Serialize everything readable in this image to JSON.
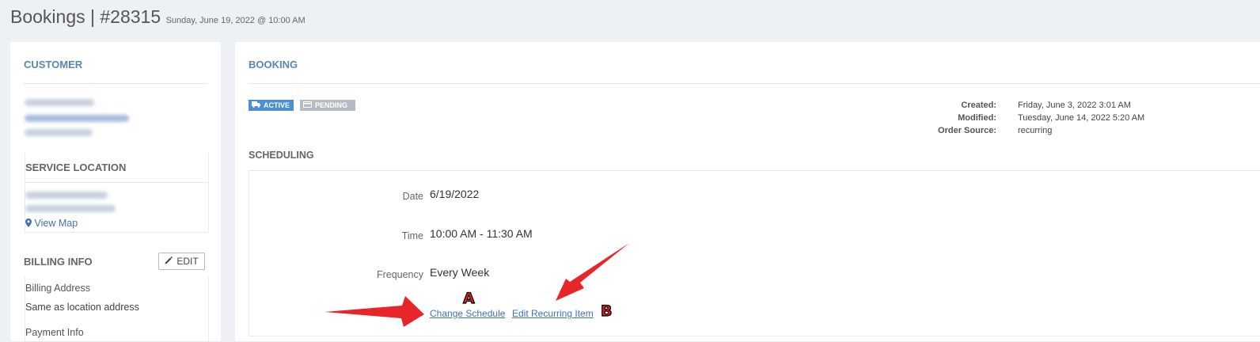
{
  "header": {
    "title": "Bookings | #28315",
    "subtitle": "Sunday, June 19, 2022 @ 10:00 AM"
  },
  "customer": {
    "title": "CUSTOMER",
    "service_location_title": "SERVICE LOCATION",
    "view_map_label": "View Map",
    "billing_info_title": "BILLING INFO",
    "edit_label": "EDIT",
    "billing_address_label": "Billing Address",
    "billing_address_value": "Same as location address",
    "payment_info_label": "Payment Info"
  },
  "booking": {
    "title": "BOOKING",
    "badges": {
      "active": "ACTIVE",
      "pending": "PENDING"
    },
    "meta": [
      {
        "key": "Created:",
        "value": "Friday, June 3, 2022 3:01 AM"
      },
      {
        "key": "Modified:",
        "value": "Tuesday, June 14, 2022 5:20 AM"
      },
      {
        "key": "Order Source:",
        "value": "recurring"
      }
    ],
    "scheduling": {
      "title": "SCHEDULING",
      "date_label": "Date",
      "date_value": "6/19/2022",
      "time_label": "Time",
      "time_value": "10:00 AM - 11:30 AM",
      "frequency_label": "Frequency",
      "frequency_value": "Every Week",
      "change_schedule_label": "Change Schedule",
      "edit_recurring_label": "Edit Recurring Item"
    }
  },
  "annotations": {
    "marker_a": "A",
    "marker_b": "B",
    "arrow_color": "#e8262a"
  },
  "colors": {
    "accent": "#5a86b3",
    "link": "#3f73b0",
    "active_badge": "#4c8fd6",
    "pending_badge": "#b5bbc2",
    "background": "#edf0f4"
  },
  "icons": {
    "map_marker": "map-marker-icon",
    "pencil": "pencil-icon",
    "truck": "truck-icon",
    "card": "card-icon"
  }
}
